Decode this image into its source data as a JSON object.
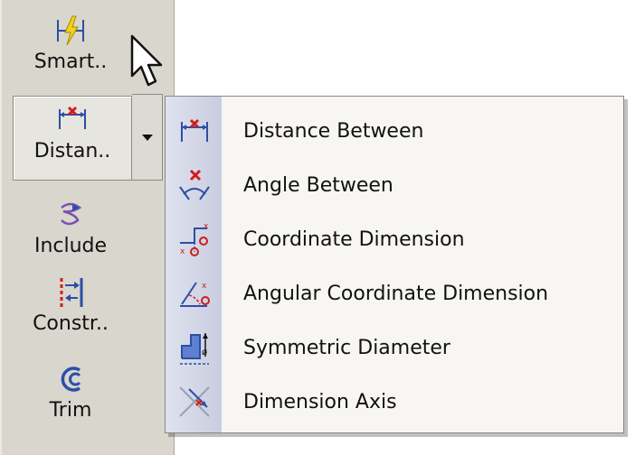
{
  "toolbar": {
    "items": [
      {
        "label": "Smart..",
        "icon": "smart-dimension-icon"
      },
      {
        "label": "Distan..",
        "icon": "distance-icon"
      },
      {
        "label": "Include",
        "icon": "include-icon"
      },
      {
        "label": "Constr..",
        "icon": "construction-icon"
      },
      {
        "label": "Trim",
        "icon": "trim-icon"
      }
    ]
  },
  "menu": {
    "items": [
      {
        "label": "Distance Between",
        "icon": "distance-between-icon"
      },
      {
        "label": "Angle Between",
        "icon": "angle-between-icon"
      },
      {
        "label": "Coordinate Dimension",
        "icon": "coordinate-dimension-icon"
      },
      {
        "label": "Angular Coordinate Dimension",
        "icon": "angular-coordinate-dimension-icon"
      },
      {
        "label": "Symmetric Diameter",
        "icon": "symmetric-diameter-icon"
      },
      {
        "label": "Dimension Axis",
        "icon": "dimension-axis-icon"
      }
    ]
  },
  "colors": {
    "toolbar_bg": "#d9d6cd",
    "menu_bg": "#f7f6f2",
    "menu_gutter": "#c9cde0",
    "icon_blue": "#2b4fa6",
    "icon_red": "#d21c1c"
  }
}
